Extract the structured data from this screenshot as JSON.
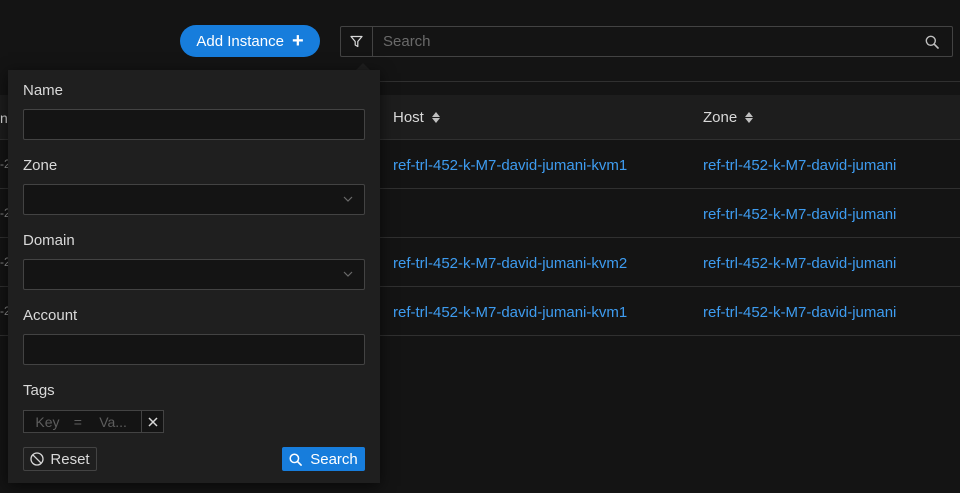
{
  "toolbar": {
    "add_instance_label": "Add Instance",
    "add_icon": "plus-icon",
    "filter_icon": "filter-icon",
    "search_placeholder": "Search",
    "search_icon": "search-icon"
  },
  "table": {
    "columns": [
      {
        "label": "Host",
        "sortable": true
      },
      {
        "label": "Zone",
        "sortable": true
      }
    ],
    "rows": [
      {
        "edge": "-2",
        "host": "ref-trl-452-k-M7-david-jumani-kvm1",
        "zone": "ref-trl-452-k-M7-david-jumani"
      },
      {
        "edge": "-2",
        "host": "",
        "zone": "ref-trl-452-k-M7-david-jumani"
      },
      {
        "edge": "-2",
        "host": "ref-trl-452-k-M7-david-jumani-kvm2",
        "zone": "ref-trl-452-k-M7-david-jumani"
      },
      {
        "edge": "-2",
        "host": "ref-trl-452-k-M7-david-jumani-kvm1",
        "zone": "ref-trl-452-k-M7-david-jumani"
      }
    ],
    "header_edge": "n"
  },
  "filter": {
    "name_label": "Name",
    "name_value": "",
    "zone_label": "Zone",
    "zone_value": "",
    "domain_label": "Domain",
    "domain_value": "",
    "account_label": "Account",
    "account_value": "",
    "tags_label": "Tags",
    "tag_key_placeholder": "Key",
    "tag_eq": "=",
    "tag_value_placeholder": "Va...",
    "tag_remove": "×",
    "reset_label": "Reset",
    "search_label": "Search"
  },
  "colors": {
    "accent": "#177ddc",
    "link": "#3e9cf0",
    "background": "#141414",
    "panel": "#1f1f1f"
  }
}
